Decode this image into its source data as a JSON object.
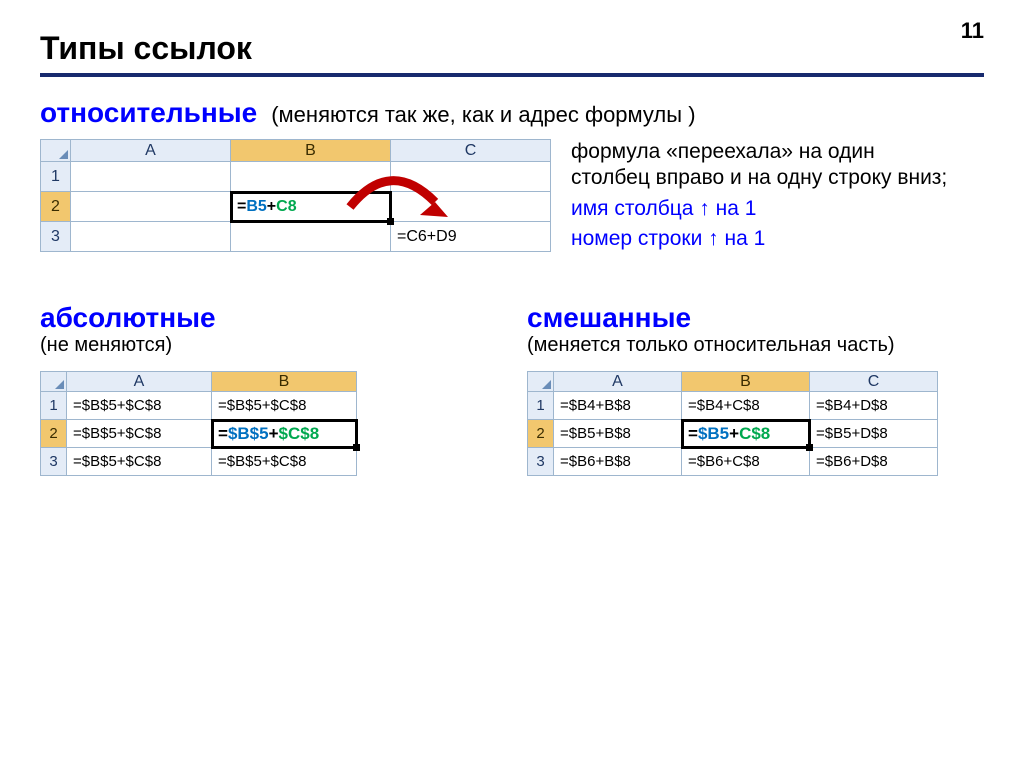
{
  "page_number": "11",
  "title": "Типы ссылок",
  "relative": {
    "heading": "относительные",
    "paren": "(меняются так же, как и адрес формулы )",
    "side_line1": "формула «переехала» на один столбец вправо и на одну строку вниз;",
    "side_blue1": "имя столбца ↑ на 1",
    "side_blue2": "номер строки ↑ на 1",
    "cols": [
      "A",
      "B",
      "C"
    ],
    "rows": [
      "1",
      "2",
      "3"
    ],
    "b2_pre": "=",
    "b2_c1": "B5",
    "b2_plus": "+",
    "b2_c2": "C8",
    "c3": "=C6+D9"
  },
  "absolute": {
    "heading": "абсолютные",
    "paren": "(не меняются)",
    "cols": [
      "A",
      "B"
    ],
    "rows": [
      "1",
      "2",
      "3"
    ],
    "cells": {
      "a1": "=$B$5+$C$8",
      "b1": "=$B$5+$C$8",
      "a2": "=$B$5+$C$8",
      "b2_pre": "=",
      "b2_c1": "$B$5",
      "b2_plus": "+",
      "b2_c2": "$C$8",
      "a3": "=$B$5+$C$8",
      "b3": "=$B$5+$C$8"
    }
  },
  "mixed": {
    "heading": "смешанные",
    "paren": "(меняется только относительная часть)",
    "cols": [
      "A",
      "B",
      "C"
    ],
    "rows": [
      "1",
      "2",
      "3"
    ],
    "cells": {
      "a1": "=$B4+B$8",
      "b1": "=$B4+C$8",
      "c1": "=$B4+D$8",
      "a2": "=$B5+B$8",
      "b2_pre": "=",
      "b2_c1": "$B5",
      "b2_plus": "+",
      "b2_c2": "C$8",
      "c2": "=$B5+D$8",
      "a3": "=$B6+B$8",
      "b3": "=$B6+C$8",
      "c3": "=$B6+D$8"
    }
  }
}
